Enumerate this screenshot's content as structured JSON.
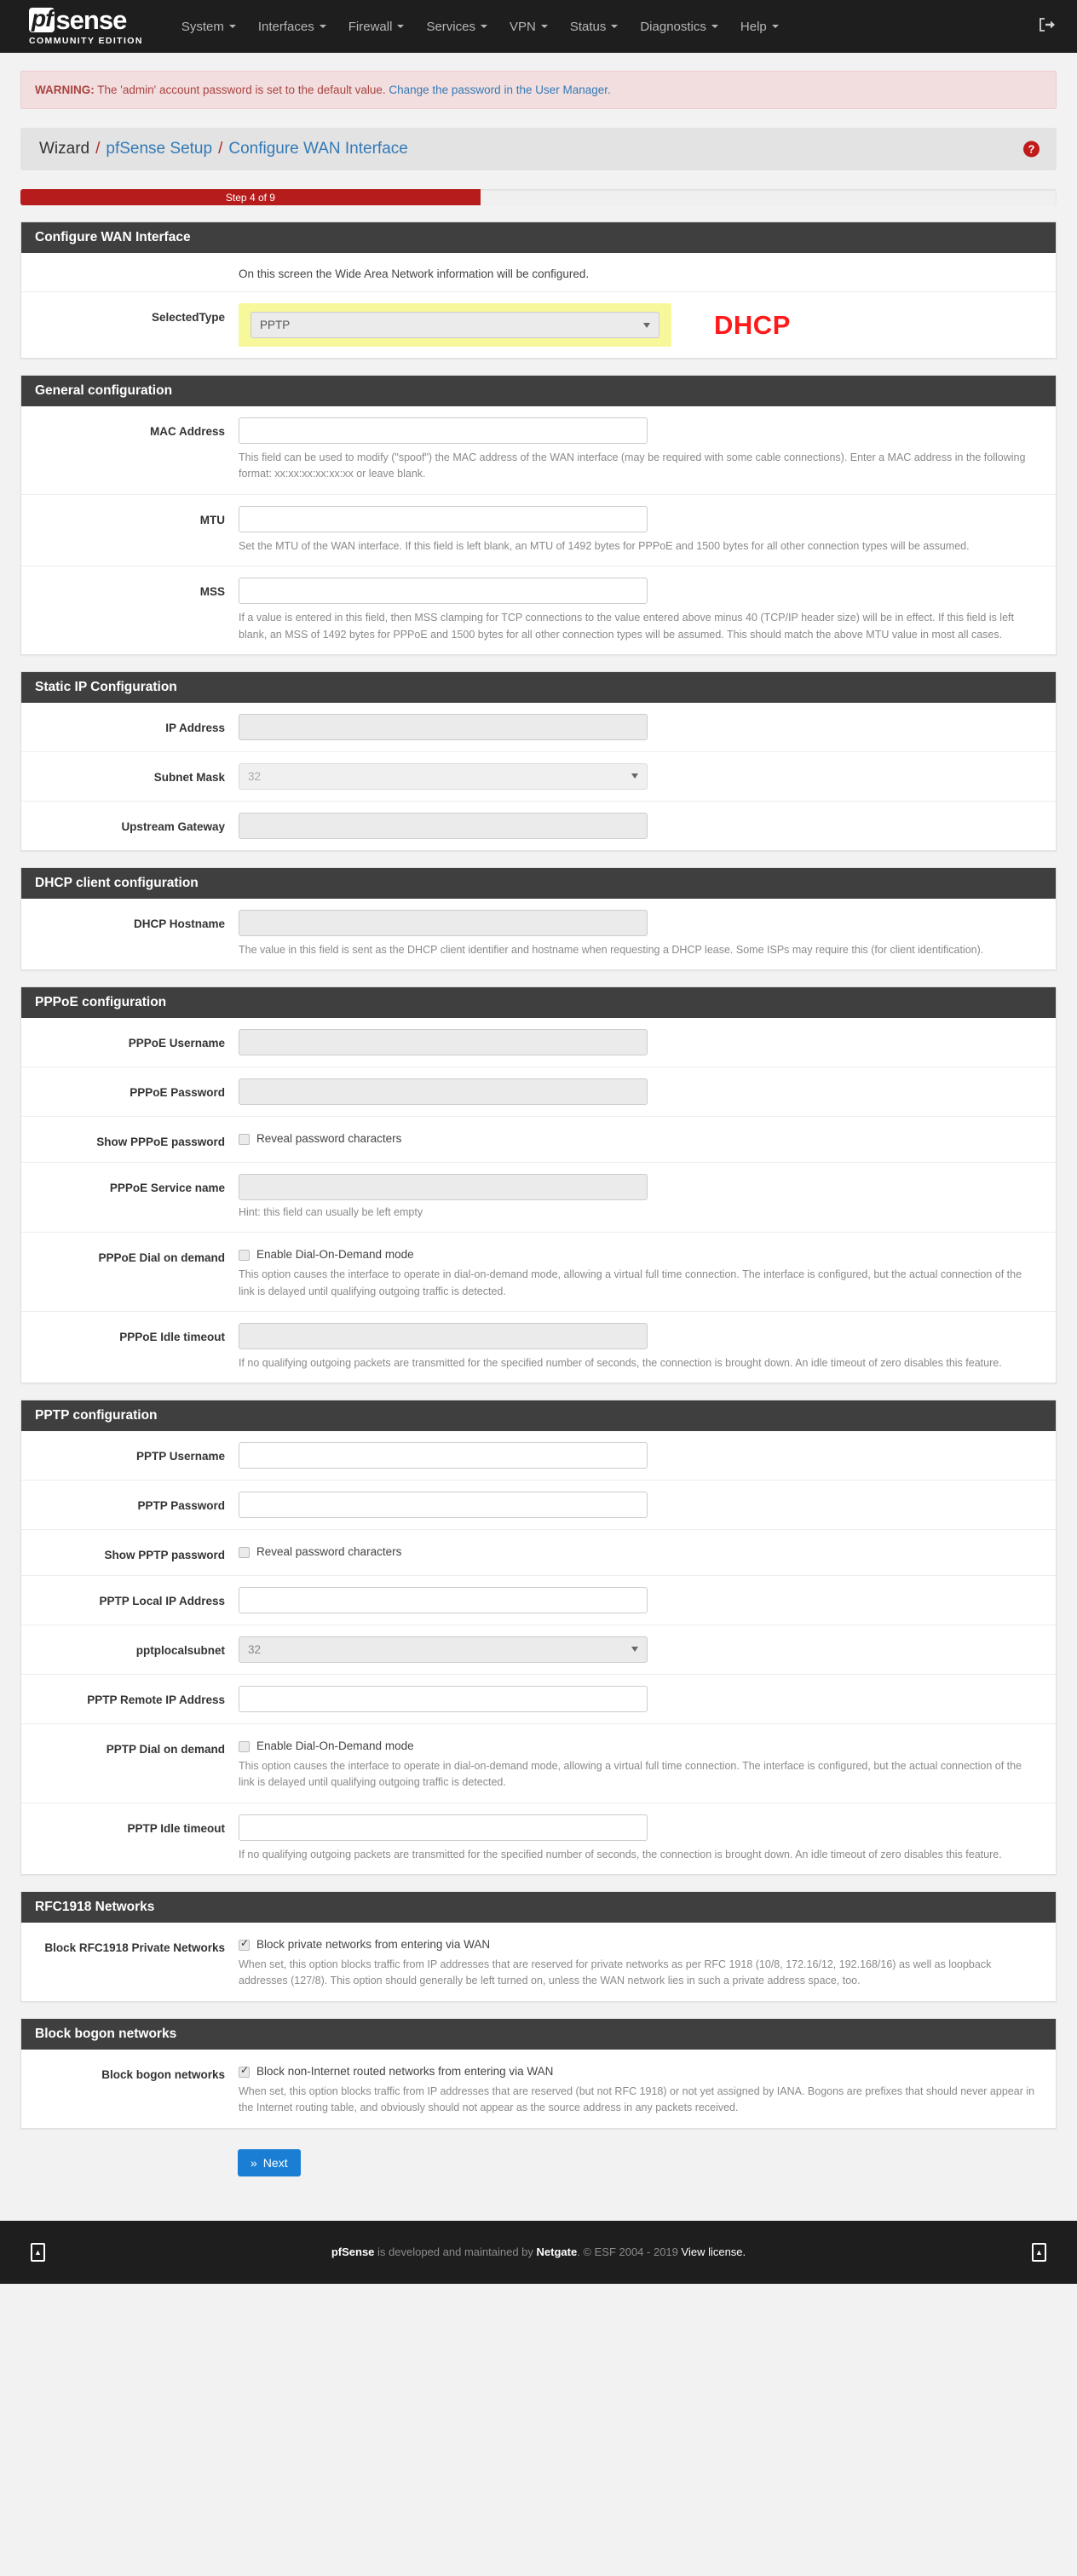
{
  "navbar": {
    "brand_pf": "pf",
    "brand_sense": "sense",
    "brand_sub": "COMMUNITY EDITION",
    "items": [
      {
        "label": "System"
      },
      {
        "label": "Interfaces"
      },
      {
        "label": "Firewall"
      },
      {
        "label": "Services"
      },
      {
        "label": "VPN"
      },
      {
        "label": "Status"
      },
      {
        "label": "Diagnostics"
      },
      {
        "label": "Help"
      }
    ],
    "logout_icon": "logout-icon"
  },
  "alert": {
    "prefix": "WARNING:",
    "text": " The 'admin' account password is set to the default value. ",
    "link": "Change the password in the User Manager."
  },
  "breadcrumb": {
    "root": "Wizard",
    "sep": "/",
    "item1": "pfSense Setup",
    "item2": "Configure WAN Interface",
    "help_icon": "?"
  },
  "progress": {
    "label": "Step 4 of 9",
    "percent": 44.4,
    "color": "#b71c1c"
  },
  "sections": {
    "wan": {
      "heading": "Configure WAN Interface",
      "intro": "On this screen the Wide Area Network information will be configured.",
      "selected_type_label": "SelectedType",
      "selected_type_value": "PPTP",
      "annotation": "DHCP",
      "annotation_color": "#ff1a1a"
    },
    "general": {
      "heading": "General configuration",
      "mac_label": "MAC Address",
      "mac_value": "",
      "mac_help": "This field can be used to modify (\"spoof\") the MAC address of the WAN interface (may be required with some cable connections). Enter a MAC address in the following format: xx:xx:xx:xx:xx:xx or leave blank.",
      "mtu_label": "MTU",
      "mtu_value": "",
      "mtu_help": "Set the MTU of the WAN interface. If this field is left blank, an MTU of 1492 bytes for PPPoE and 1500 bytes for all other connection types will be assumed.",
      "mss_label": "MSS",
      "mss_value": "",
      "mss_help": "If a value is entered in this field, then MSS clamping for TCP connections to the value entered above minus 40 (TCP/IP header size) will be in effect. If this field is left blank, an MSS of 1492 bytes for PPPoE and 1500 bytes for all other connection types will be assumed. This should match the above MTU value in most all cases."
    },
    "static": {
      "heading": "Static IP Configuration",
      "ip_label": "IP Address",
      "ip_value": "",
      "subnet_label": "Subnet Mask",
      "subnet_value": "32",
      "gateway_label": "Upstream Gateway",
      "gateway_value": ""
    },
    "dhcp": {
      "heading": "DHCP client configuration",
      "hostname_label": "DHCP Hostname",
      "hostname_value": "",
      "hostname_help": "The value in this field is sent as the DHCP client identifier and hostname when requesting a DHCP lease. Some ISPs may require this (for client identification)."
    },
    "pppoe": {
      "heading": "PPPoE configuration",
      "username_label": "PPPoE Username",
      "username_value": "",
      "password_label": "PPPoE Password",
      "password_value": "",
      "show_label": "Show PPPoE password",
      "show_checkbox_label": "Reveal password characters",
      "service_label": "PPPoE Service name",
      "service_value": "",
      "service_help": "Hint: this field can usually be left empty",
      "dial_label": "PPPoE Dial on demand",
      "dial_checkbox_label": "Enable Dial-On-Demand mode",
      "dial_help": "This option causes the interface to operate in dial-on-demand mode, allowing a virtual full time connection. The interface is configured, but the actual connection of the link is delayed until qualifying outgoing traffic is detected.",
      "idle_label": "PPPoE Idle timeout",
      "idle_value": "",
      "idle_help": "If no qualifying outgoing packets are transmitted for the specified number of seconds, the connection is brought down. An idle timeout of zero disables this feature."
    },
    "pptp": {
      "heading": "PPTP configuration",
      "username_label": "PPTP Username",
      "username_value": "",
      "password_label": "PPTP Password",
      "password_value": "",
      "show_label": "Show PPTP password",
      "show_checkbox_label": "Reveal password characters",
      "local_ip_label": "PPTP Local IP Address",
      "local_ip_value": "",
      "localsubnet_label": "pptplocalsubnet",
      "localsubnet_value": "32",
      "remote_ip_label": "PPTP Remote IP Address",
      "remote_ip_value": "",
      "dial_label": "PPTP Dial on demand",
      "dial_checkbox_label": "Enable Dial-On-Demand mode",
      "dial_help": "This option causes the interface to operate in dial-on-demand mode, allowing a virtual full time connection. The interface is configured, but the actual connection of the link is delayed until qualifying outgoing traffic is detected.",
      "idle_label": "PPTP Idle timeout",
      "idle_value": "",
      "idle_help": "If no qualifying outgoing packets are transmitted for the specified number of seconds, the connection is brought down. An idle timeout of zero disables this feature."
    },
    "rfc1918": {
      "heading": "RFC1918 Networks",
      "label": "Block RFC1918 Private Networks",
      "checkbox_label": "Block private networks from entering via WAN",
      "checked": true,
      "help": "When set, this option blocks traffic from IP addresses that are reserved for private networks as per RFC 1918 (10/8, 172.16/12, 192.168/16) as well as loopback addresses (127/8). This option should generally be left turned on, unless the WAN network lies in such a private address space, too."
    },
    "bogon": {
      "heading": "Block bogon networks",
      "label": "Block bogon networks",
      "checkbox_label": "Block non-Internet routed networks from entering via WAN",
      "checked": true,
      "help": "When set, this option blocks traffic from IP addresses that are reserved (but not RFC 1918) or not yet assigned by IANA. Bogons are prefixes that should never appear in the Internet routing table, and obviously should not appear as the source address in any packets received."
    }
  },
  "next_button": {
    "label": "Next",
    "icon": "»",
    "color": "#1a7fd4"
  },
  "footer": {
    "brand": "pfSense",
    "text1": " is developed and maintained by ",
    "netgate": "Netgate",
    "text2": ". © ESF 2004 - 2019 ",
    "license": "View license."
  }
}
